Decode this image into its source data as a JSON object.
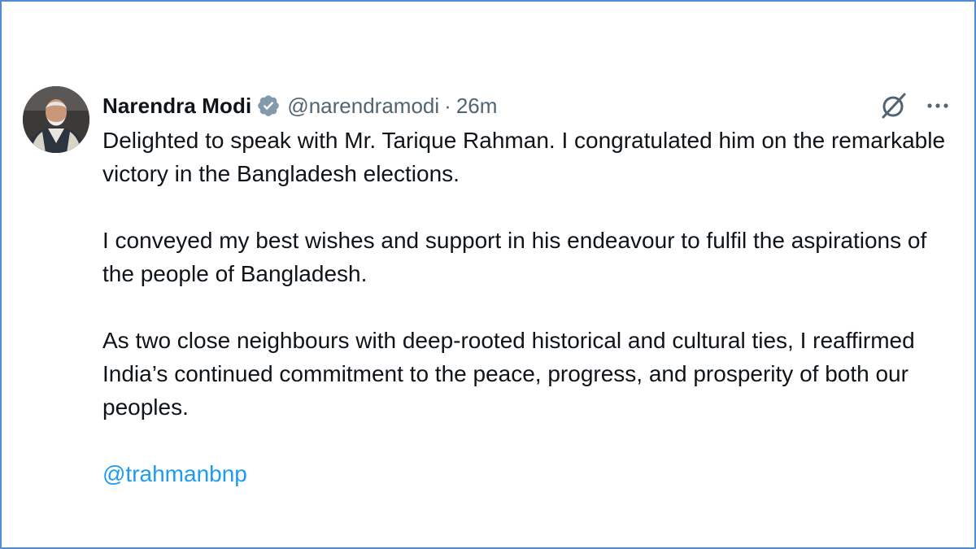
{
  "post": {
    "author": {
      "name": "Narendra Modi",
      "handle": "@narendramodi",
      "verified": true,
      "avatar_icon": "profile-photo"
    },
    "separator": "·",
    "timestamp": "26m",
    "paragraphs": [
      "Delighted to speak with Mr. Tarique Rahman. I congratulated him on the remarkable victory in the Bangladesh elections.",
      "I conveyed my best wishes and support in his endeavour to fulfil the aspirations of the people of Bangladesh.",
      "As two close neighbours with deep-rooted historical and cultural ties, I reaffirmed India’s continued commitment to the peace, progress, and prosperity of both our peoples."
    ],
    "mention": "@trahmanbnp"
  },
  "icons": {
    "verified": "verified-badge-icon",
    "grok": "grok-icon",
    "more": "more-options-icon"
  },
  "colors": {
    "frame_border": "#4f8bd1",
    "text_primary": "#0f1419",
    "text_secondary": "#536471",
    "link": "#1d9bf0",
    "verified_badge": "#829aab"
  }
}
